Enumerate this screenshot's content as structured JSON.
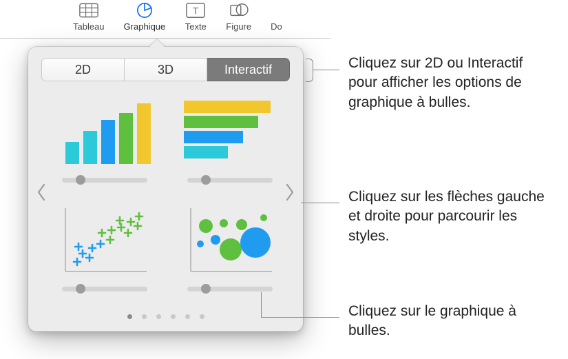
{
  "toolbar": {
    "items": [
      {
        "label": "Tableau"
      },
      {
        "label": "Graphique"
      },
      {
        "label": "Texte"
      },
      {
        "label": "Figure"
      },
      {
        "label": "Do"
      }
    ],
    "active_index": 1
  },
  "popover": {
    "segments": {
      "opt0": "2D",
      "opt1": "3D",
      "opt2": "Interactif",
      "selected": 2
    },
    "thumbnails": [
      {
        "name": "interactive-column-chart"
      },
      {
        "name": "interactive-bar-chart"
      },
      {
        "name": "interactive-scatter-chart"
      },
      {
        "name": "interactive-bubble-chart"
      }
    ],
    "page_count": 6,
    "current_page": 0
  },
  "callouts": {
    "c1": "Cliquez sur 2D ou Interactif pour afficher les options de graphique à bulles.",
    "c2": "Cliquez sur les flèches gauche et droite pour parcourir les styles.",
    "c3": "Cliquez sur le graphique à bulles."
  },
  "colors": {
    "green": "#5fbf3f",
    "blue": "#1f9cef",
    "cyan": "#2cc9d9",
    "yellow": "#f2c72d"
  }
}
